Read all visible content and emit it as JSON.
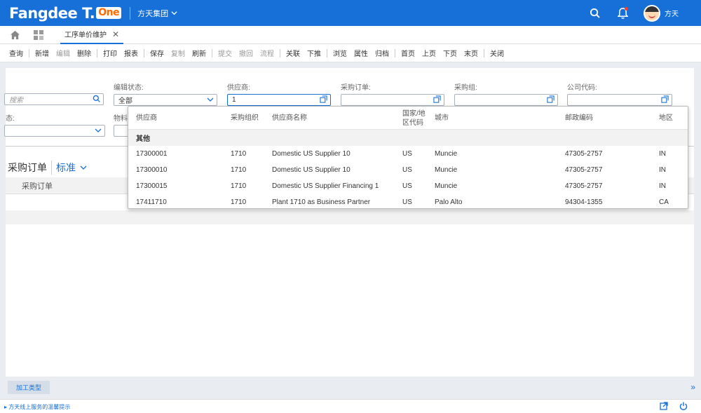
{
  "header": {
    "logo_text": "Fangdee T.",
    "logo_badge": "One",
    "org_name": "方天集团",
    "user_name": "方天"
  },
  "tabs": {
    "active_label": "工序单价维护"
  },
  "toolbar": {
    "items": [
      "查询",
      "新增",
      "编辑",
      "删除",
      "打印",
      "报表",
      "保存",
      "复制",
      "刷新",
      "提交",
      "撤回",
      "流程",
      "关联",
      "下推",
      "浏览",
      "属性",
      "归档",
      "首页",
      "上页",
      "下页",
      "末页",
      "关闭"
    ]
  },
  "filters": {
    "search_placeholder": "搜索",
    "edit_status_label": "编辑状态:",
    "edit_status_value": "全部",
    "supplier_label": "供应商:",
    "supplier_value": "1",
    "po_label": "采购订单:",
    "purch_group_label": "采购组:",
    "company_code_label": "公司代码:",
    "status_label_partial": "态:",
    "material_label_partial": "物料"
  },
  "section": {
    "title": "采购订单",
    "variant": "标准",
    "column_header": "采购订单"
  },
  "popup": {
    "headers": {
      "supplier": "供应商",
      "purch_org": "采购组织",
      "supplier_name": "供应商名称",
      "country_1": "国家/地",
      "country_2": "区代码",
      "city": "城市",
      "postal": "邮政编码",
      "region": "地区"
    },
    "group_label": "其他",
    "rows": [
      {
        "supplier": "17300001",
        "org": "1710",
        "name": "Domestic US Supplier 10",
        "country": "US",
        "city": "Muncie",
        "postal": "47305-2757",
        "region": "IN"
      },
      {
        "supplier": "17300010",
        "org": "1710",
        "name": "Domestic US Supplier 10",
        "country": "US",
        "city": "Muncie",
        "postal": "47305-2757",
        "region": "IN"
      },
      {
        "supplier": "17300015",
        "org": "1710",
        "name": "Domestic US Supplier Financing 1",
        "country": "US",
        "city": "Muncie",
        "postal": "47305-2757",
        "region": "IN"
      },
      {
        "supplier": "17411710",
        "org": "1710",
        "name": "Plant 1710 as Business Partner",
        "country": "US",
        "city": "Palo Alto",
        "postal": "94304-1355",
        "region": "CA"
      }
    ]
  },
  "bottom": {
    "tab_label": "加工类型",
    "status_text": "方天线上服务的温馨提示"
  },
  "colors": {
    "brand": "#1670d8",
    "badge": "#ff6b00"
  }
}
